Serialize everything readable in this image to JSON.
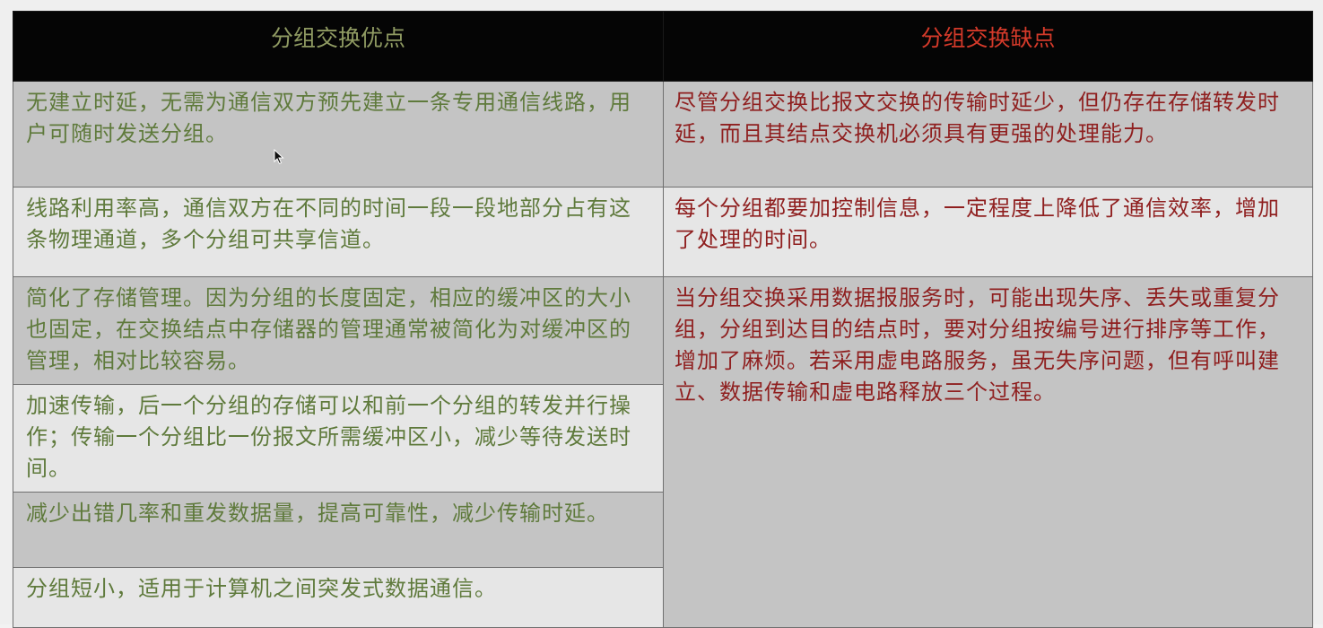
{
  "header": {
    "advantages_title": "分组交换优点",
    "disadvantages_title": "分组交换缺点"
  },
  "advantages": [
    "无建立时延，无需为通信双方预先建立一条专用通信线路，用户可随时发送分组。",
    "线路利用率高，通信双方在不同的时间一段一段地部分占有这条物理通道，多个分组可共享信道。",
    "简化了存储管理。因为分组的长度固定，相应的缓冲区的大小也固定，在交换结点中存储器的管理通常被简化为对缓冲区的管理，相对比较容易。",
    "加速传输，后一个分组的存储可以和前一个分组的转发并行操作；传输一个分组比一份报文所需缓冲区小，减少等待发送时间。",
    "减少出错几率和重发数据量，提高可靠性，减少传输时延。",
    "分组短小，适用于计算机之间突发式数据通信。"
  ],
  "disadvantages": [
    "尽管分组交换比报文交换的传输时延少，但仍存在存储转发时延，而且其结点交换机必须具有更强的处理能力。",
    "每个分组都要加控制信息，一定程度上降低了通信效率，增加了处理的时间。",
    "当分组交换采用数据报服务时，可能出现失序、丢失或重复分组，分组到达目的结点时，要对分组按编号进行排序等工作，增加了麻烦。若采用虚电路服务，虽无失序问题，但有呼叫建立、数据传输和虚电路释放三个过程。"
  ],
  "colors": {
    "header_bg": "#050505",
    "advantage_text": "#5f7a3c",
    "disadvantage_text": "#8f1f1f",
    "disadvantage_title": "#d43a2a",
    "row_dark": "#c4c4c4",
    "row_light": "#e6e6e6"
  }
}
